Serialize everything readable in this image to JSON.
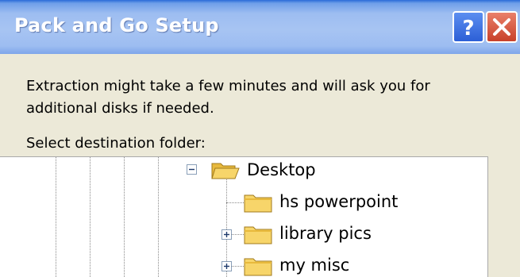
{
  "window": {
    "title": "Pack and Go Setup",
    "help_label": "?"
  },
  "message": {
    "line1": "Extraction might take a few minutes and will ask you for",
    "line2": "additional disks if needed.",
    "prompt": "Select destination folder:"
  },
  "tree": {
    "nodes": [
      {
        "label": "Desktop",
        "expander": "minus"
      },
      {
        "label": "hs powerpoint",
        "expander": "none"
      },
      {
        "label": "library pics",
        "expander": "plus"
      },
      {
        "label": "my misc",
        "expander": "plus"
      }
    ]
  },
  "colors": {
    "titlebar": "#9dbdf1",
    "help_button": "#3a6fe0",
    "close_button": "#d9573c",
    "folder": "#f7d56a"
  }
}
